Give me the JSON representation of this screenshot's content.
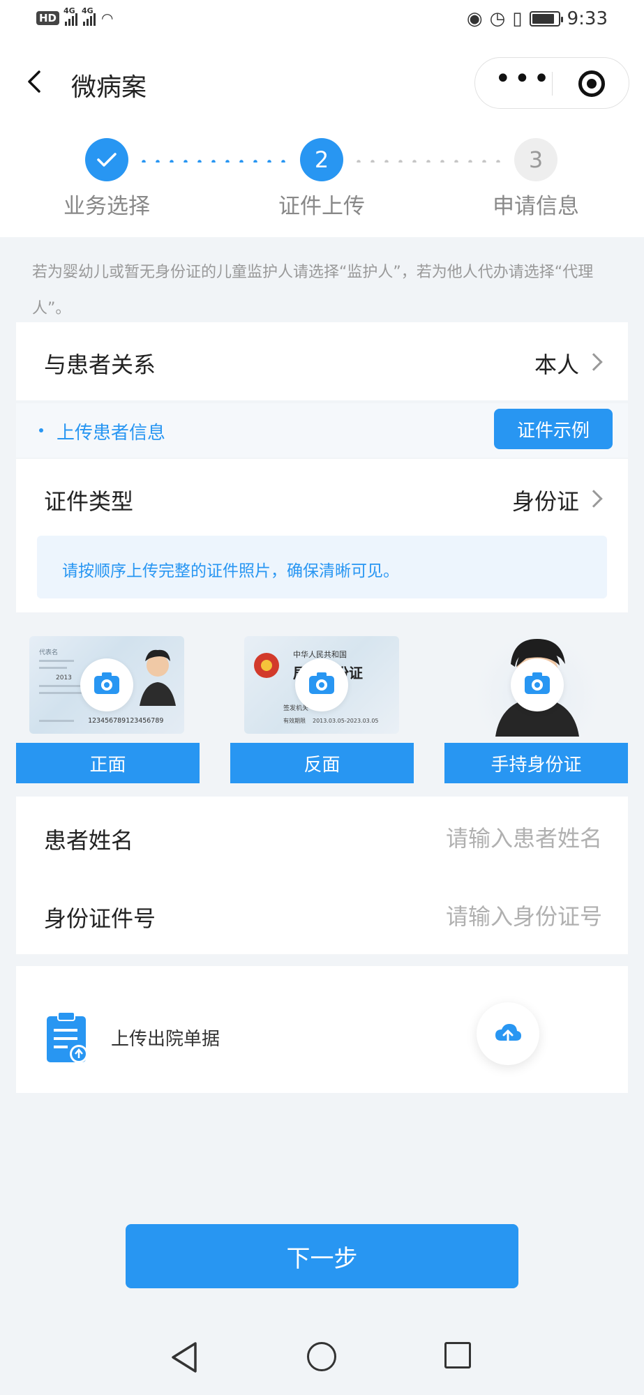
{
  "status_bar": {
    "hd": "HD",
    "net1": "4G",
    "net2": "4G",
    "time": "9:33"
  },
  "header": {
    "title": "微病案"
  },
  "steps": [
    {
      "label": "业务选择",
      "number": "1",
      "state": "done"
    },
    {
      "label": "证件上传",
      "number": "2",
      "state": "active"
    },
    {
      "label": "申请信息",
      "number": "3",
      "state": "pending"
    }
  ],
  "notice": "若为婴幼儿或暂无身份证的儿童监护人请选择“监护人”，若为他人代办请选择“代理人”。",
  "relation": {
    "label": "与患者关系",
    "value": "本人"
  },
  "upload_section": {
    "label": "上传患者信息",
    "example_button": "证件示例"
  },
  "id_type": {
    "label": "证件类型",
    "value": "身份证",
    "tip": "请按顺序上传完整的证件照片，确保清晰可见。"
  },
  "photos": {
    "front_label": "正面",
    "back_label": "反面",
    "hold_label": "手持身份证",
    "front_card": {
      "name_field": "代表名",
      "year": "2013",
      "number": "123456789123456789"
    },
    "back_card": {
      "country": "中华人民共和国",
      "title": "居民身份证",
      "authority": "签发机关",
      "validity_label": "有效期限",
      "validity": "2013.03.05-2023.03.05"
    }
  },
  "form": {
    "name_label": "患者姓名",
    "name_placeholder": "请输入患者姓名",
    "id_label": "身份证件号",
    "id_placeholder": "请输入身份证号"
  },
  "discharge": {
    "label": "上传出院单据"
  },
  "next_button": "下一步",
  "colors": {
    "accent": "#2896f2",
    "background": "#f1f4f7"
  }
}
